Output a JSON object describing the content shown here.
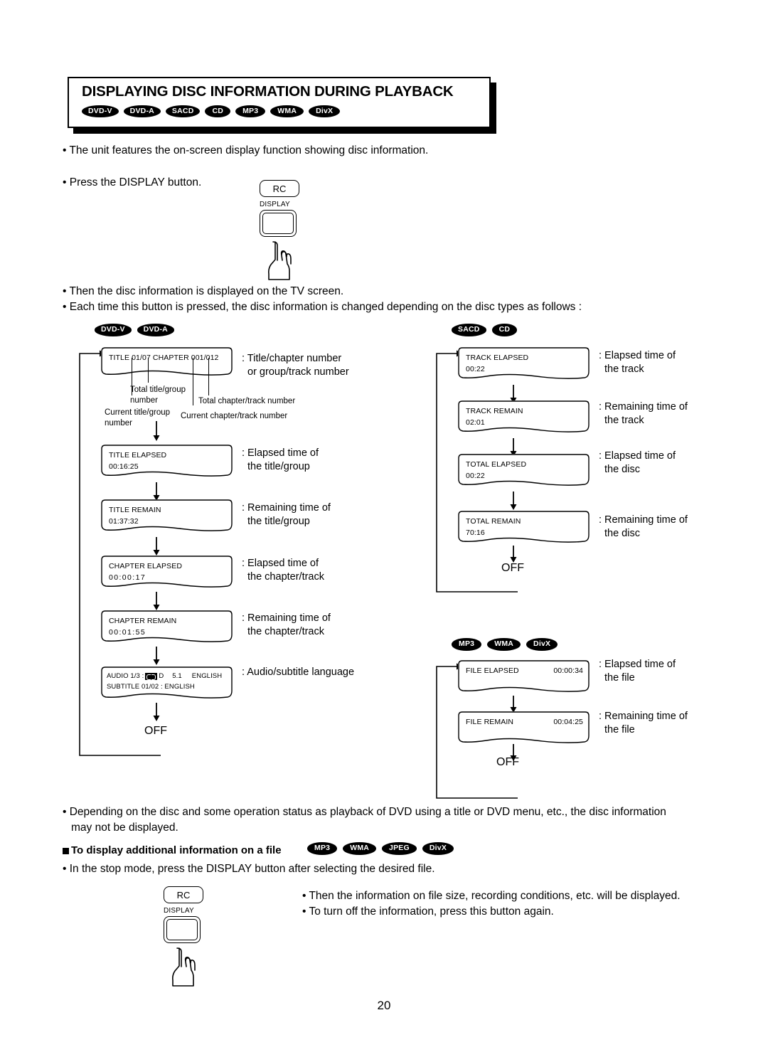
{
  "header": {
    "title": "DISPLAYING DISC INFORMATION DURING PLAYBACK",
    "badges": [
      "DVD-V",
      "DVD-A",
      "SACD",
      "CD",
      "MP3",
      "WMA",
      "DivX"
    ]
  },
  "intro": {
    "line1": "The unit features the on-screen display function showing disc information.",
    "line2": "Press the DISPLAY button.",
    "line3": "Then the disc information is displayed on the TV screen.",
    "line4": "Each time this button is pressed, the disc information is changed depending on the disc types as follows :"
  },
  "remote_top": {
    "chip": "RC",
    "label": "DISPLAY"
  },
  "remote_bottom": {
    "chip": "RC",
    "label": "DISPLAY"
  },
  "flow": {
    "dvd": {
      "badges": [
        "DVD-V",
        "DVD-A"
      ],
      "steps": [
        {
          "line1": "TITLE 01/07 CHAPTER 001/012",
          "line2": "",
          "caption1": ": Title/chapter number",
          "caption2": "or group/track number"
        },
        {
          "line1": "TITLE ELAPSED",
          "line2": "00:16:25",
          "caption1": ": Elapsed time of",
          "caption2": "the title/group"
        },
        {
          "line1": "TITLE REMAIN",
          "line2": "01:37:32",
          "caption1": ": Remaining time of",
          "caption2": "the title/group"
        },
        {
          "line1": "CHAPTER ELAPSED",
          "line2": "00:00:17",
          "caption1": ": Elapsed time of",
          "caption2": "the chapter/track"
        },
        {
          "line1": "CHAPTER REMAIN",
          "line2": "00:01:55",
          "caption1": ": Remaining time of",
          "caption2": "the chapter/track"
        }
      ],
      "audio_step": {
        "audio_prefix": "AUDIO 1/3 :",
        "audio_codec": "D",
        "audio_channels": "5.1",
        "audio_language": "ENGLISH",
        "subtitle_line": "SUBTITLE  01/02  :  ENGLISH",
        "caption1": ": Audio/subtitle language"
      },
      "annotations": {
        "total_title": "Total title/group",
        "total_title_2": "number",
        "current_title": "Current title/group",
        "current_title_2": "number",
        "total_chapter": "Total chapter/track number",
        "current_chapter": "Current chapter/track number"
      },
      "off": "OFF"
    },
    "sacd": {
      "badges": [
        "SACD",
        "CD"
      ],
      "steps": [
        {
          "line1": "TRACK ELAPSED",
          "line2": "00:22",
          "caption1": ": Elapsed time of",
          "caption2": "the track"
        },
        {
          "line1": "TRACK REMAIN",
          "line2": "02:01",
          "caption1": ": Remaining time of",
          "caption2": "the track"
        },
        {
          "line1": "TOTAL ELAPSED",
          "line2": "00:22",
          "caption1": ": Elapsed time of",
          "caption2": "the disc"
        },
        {
          "line1": "TOTAL REMAIN",
          "line2": "70:16",
          "caption1": ": Remaining time of",
          "caption2": "the disc"
        }
      ],
      "off": "OFF"
    },
    "mp3": {
      "badges": [
        "MP3",
        "WMA",
        "DivX"
      ],
      "steps": [
        {
          "line1": "FILE  ELAPSED",
          "line2": "00:00:34",
          "caption1": ": Elapsed time of",
          "caption2": "the file"
        },
        {
          "line1": "FILE  REMAIN",
          "line2": "00:04:25",
          "caption1": ": Remaining time of",
          "caption2": "the file"
        }
      ],
      "off": "OFF"
    }
  },
  "notes": {
    "depend_line1": "Depending on the disc and some operation status as playback of DVD using a title or DVD menu, etc., the disc information",
    "depend_line2": "may not be displayed.",
    "subheading": "To display additional information on a file",
    "subheading_badges": [
      "MP3",
      "WMA",
      "JPEG",
      "DivX"
    ],
    "stop_mode": "In the stop mode, press the DISPLAY button after selecting the desired file.",
    "then_info": "Then the information on file size, recording conditions, etc. will be displayed.",
    "turn_off": "To turn off the information, press this button again."
  },
  "page_number": "20"
}
